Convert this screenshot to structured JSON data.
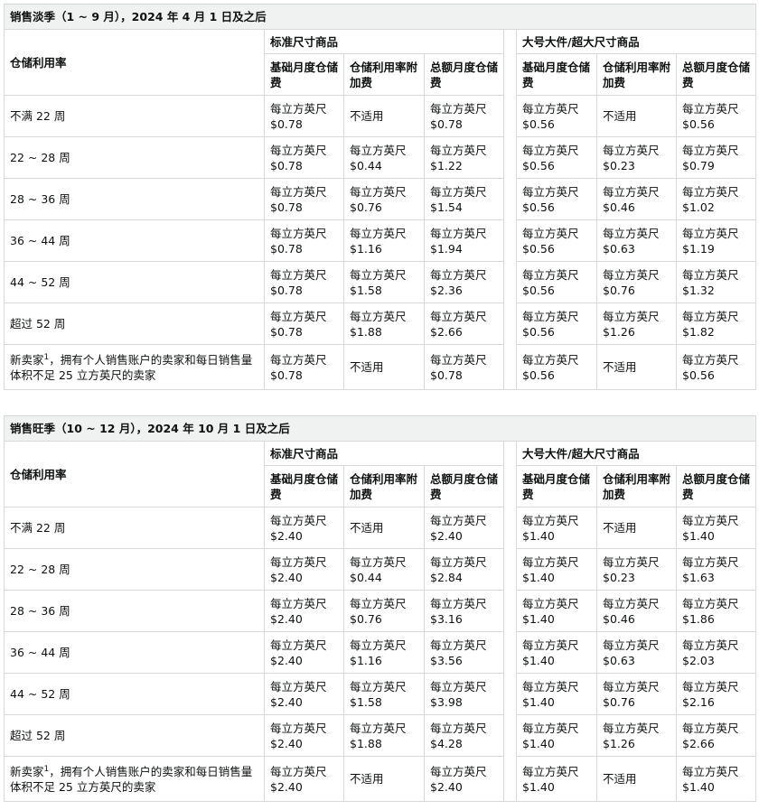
{
  "tables": [
    {
      "title": "销售淡季（1 ~ 9 月），2024 年 4 月 1 日及之后",
      "row_header": "仓储利用率",
      "group_standard": "标准尺寸商品",
      "group_large": "大号大件/超大尺寸商品",
      "col_base": "基础月度仓储费",
      "col_surcharge": "仓储利用率附加费",
      "col_total": "总额月度仓储费",
      "rows": [
        {
          "label": "不满 22 周",
          "s_base": [
            "每立方英尺",
            "$0.78"
          ],
          "s_sur": [
            "不适用"
          ],
          "s_tot": [
            "每立方英尺",
            "$0.78"
          ],
          "l_base": [
            "每立方英尺",
            "$0.56"
          ],
          "l_sur": [
            "不适用"
          ],
          "l_tot": [
            "每立方英尺",
            "$0.56"
          ]
        },
        {
          "label": "22 ~ 28 周",
          "s_base": [
            "每立方英尺",
            "$0.78"
          ],
          "s_sur": [
            "每立方英尺",
            "$0.44"
          ],
          "s_tot": [
            "每立方英尺",
            "$1.22"
          ],
          "l_base": [
            "每立方英尺",
            "$0.56"
          ],
          "l_sur": [
            "每立方英尺",
            "$0.23"
          ],
          "l_tot": [
            "每立方英尺",
            "$0.79"
          ]
        },
        {
          "label": "28 ~ 36 周",
          "s_base": [
            "每立方英尺",
            "$0.78"
          ],
          "s_sur": [
            "每立方英尺",
            "$0.76"
          ],
          "s_tot": [
            "每立方英尺",
            "$1.54"
          ],
          "l_base": [
            "每立方英尺",
            "$0.56"
          ],
          "l_sur": [
            "每立方英尺",
            "$0.46"
          ],
          "l_tot": [
            "每立方英尺",
            "$1.02"
          ]
        },
        {
          "label": "36 ~ 44 周",
          "s_base": [
            "每立方英尺",
            "$0.78"
          ],
          "s_sur": [
            "每立方英尺",
            "$1.16"
          ],
          "s_tot": [
            "每立方英尺",
            "$1.94"
          ],
          "l_base": [
            "每立方英尺",
            "$0.56"
          ],
          "l_sur": [
            "每立方英尺",
            "$0.63"
          ],
          "l_tot": [
            "每立方英尺",
            "$1.19"
          ]
        },
        {
          "label": "44 ~ 52 周",
          "s_base": [
            "每立方英尺",
            "$0.78"
          ],
          "s_sur": [
            "每立方英尺",
            "$1.58"
          ],
          "s_tot": [
            "每立方英尺",
            "$2.36"
          ],
          "l_base": [
            "每立方英尺",
            "$0.56"
          ],
          "l_sur": [
            "每立方英尺",
            "$0.76"
          ],
          "l_tot": [
            "每立方英尺",
            "$1.32"
          ]
        },
        {
          "label": "超过 52 周",
          "s_base": [
            "每立方英尺",
            "$0.78"
          ],
          "s_sur": [
            "每立方英尺",
            "$1.88"
          ],
          "s_tot": [
            "每立方英尺",
            "$2.66"
          ],
          "l_base": [
            "每立方英尺",
            "$0.56"
          ],
          "l_sur": [
            "每立方英尺",
            "$1.26"
          ],
          "l_tot": [
            "每立方英尺",
            "$1.82"
          ]
        },
        {
          "label": "新卖家",
          "label_sup": "1",
          "label_rest": "，拥有个人销售账户的卖家和每日销售量体积不足 25 立方英尺的卖家",
          "s_base": [
            "每立方英尺",
            "$0.78"
          ],
          "s_sur": [
            "不适用"
          ],
          "s_tot": [
            "每立方英尺",
            "$0.78"
          ],
          "l_base": [
            "每立方英尺",
            "$0.56"
          ],
          "l_sur": [
            "不适用"
          ],
          "l_tot": [
            "每立方英尺",
            "$0.56"
          ]
        }
      ]
    },
    {
      "title": "销售旺季（10 ~ 12 月），2024 年 10 月 1 日及之后",
      "row_header": "仓储利用率",
      "group_standard": "标准尺寸商品",
      "group_large": "大号大件/超大尺寸商品",
      "col_base": "基础月度仓储费",
      "col_surcharge": "仓储利用率附加费",
      "col_total": "总额月度仓储费",
      "rows": [
        {
          "label": "不满 22 周",
          "s_base": [
            "每立方英尺",
            "$2.40"
          ],
          "s_sur": [
            "不适用"
          ],
          "s_tot": [
            "每立方英尺",
            "$2.40"
          ],
          "l_base": [
            "每立方英尺",
            "$1.40"
          ],
          "l_sur": [
            "不适用"
          ],
          "l_tot": [
            "每立方英尺",
            "$1.40"
          ]
        },
        {
          "label": "22 ~ 28 周",
          "s_base": [
            "每立方英尺",
            "$2.40"
          ],
          "s_sur": [
            "每立方英尺",
            "$0.44"
          ],
          "s_tot": [
            "每立方英尺",
            "$2.84"
          ],
          "l_base": [
            "每立方英尺",
            "$1.40"
          ],
          "l_sur": [
            "每立方英尺",
            "$0.23"
          ],
          "l_tot": [
            "每立方英尺",
            "$1.63"
          ]
        },
        {
          "label": "28 ~ 36 周",
          "s_base": [
            "每立方英尺",
            "$2.40"
          ],
          "s_sur": [
            "每立方英尺",
            "$0.76"
          ],
          "s_tot": [
            "每立方英尺",
            "$3.16"
          ],
          "l_base": [
            "每立方英尺",
            "$1.40"
          ],
          "l_sur": [
            "每立方英尺",
            "$0.46"
          ],
          "l_tot": [
            "每立方英尺",
            "$1.86"
          ]
        },
        {
          "label": "36 ~ 44 周",
          "s_base": [
            "每立方英尺",
            "$2.40"
          ],
          "s_sur": [
            "每立方英尺",
            "$1.16"
          ],
          "s_tot": [
            "每立方英尺",
            "$3.56"
          ],
          "l_base": [
            "每立方英尺",
            "$1.40"
          ],
          "l_sur": [
            "每立方英尺",
            "$0.63"
          ],
          "l_tot": [
            "每立方英尺",
            "$2.03"
          ]
        },
        {
          "label": "44 ~ 52 周",
          "s_base": [
            "每立方英尺",
            "$2.40"
          ],
          "s_sur": [
            "每立方英尺",
            "$1.58"
          ],
          "s_tot": [
            "每立方英尺",
            "$3.98"
          ],
          "l_base": [
            "每立方英尺",
            "$1.40"
          ],
          "l_sur": [
            "每立方英尺",
            "$0.76"
          ],
          "l_tot": [
            "每立方英尺",
            "$2.16"
          ]
        },
        {
          "label": "超过 52 周",
          "s_base": [
            "每立方英尺",
            "$2.40"
          ],
          "s_sur": [
            "每立方英尺",
            "$1.88"
          ],
          "s_tot": [
            "每立方英尺",
            "$4.28"
          ],
          "l_base": [
            "每立方英尺",
            "$1.40"
          ],
          "l_sur": [
            "每立方英尺",
            "$1.26"
          ],
          "l_tot": [
            "每立方英尺",
            "$2.66"
          ]
        },
        {
          "label": "新卖家",
          "label_sup": "1",
          "label_rest": "，拥有个人销售账户的卖家和每日销售量体积不足 25 立方英尺的卖家",
          "s_base": [
            "每立方英尺",
            "$2.40"
          ],
          "s_sur": [
            "不适用"
          ],
          "s_tot": [
            "每立方英尺",
            "$2.40"
          ],
          "l_base": [
            "每立方英尺",
            "$1.40"
          ],
          "l_sur": [
            "不适用"
          ],
          "l_tot": [
            "每立方英尺",
            "$1.40"
          ]
        }
      ]
    }
  ]
}
